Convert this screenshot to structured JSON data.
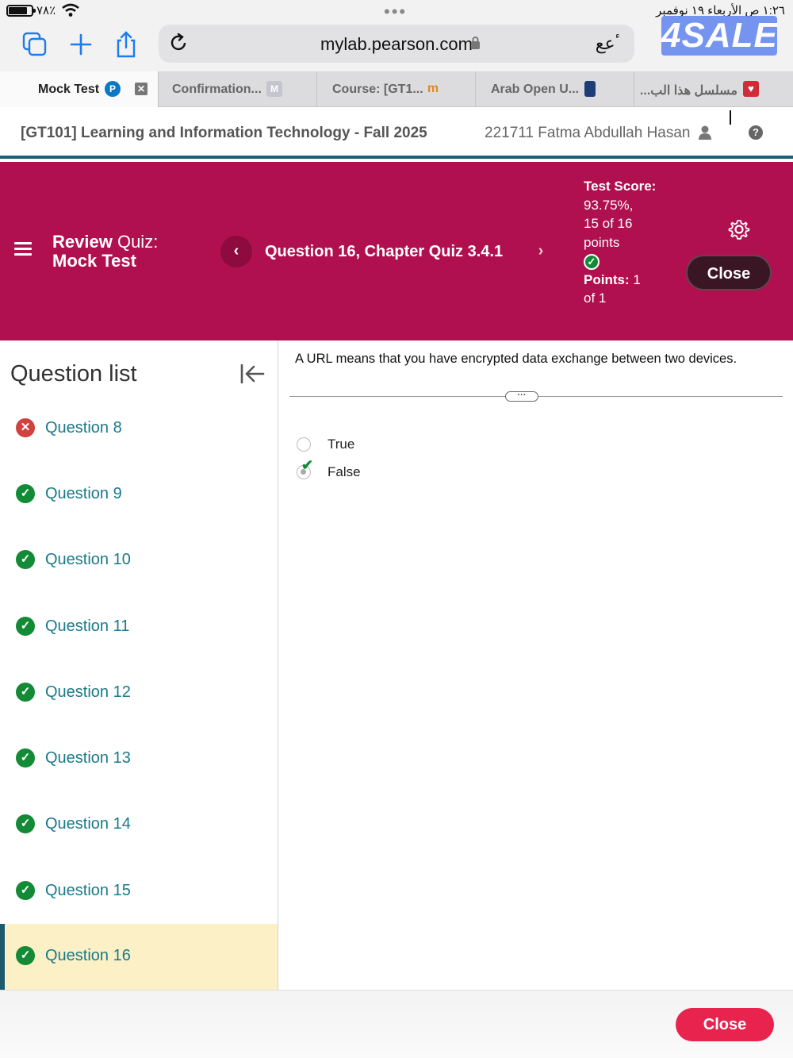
{
  "status_bar": {
    "battery_percent": "٧٨٪",
    "battery_level": 0.78,
    "time_date": "١:٢٦ ص   الأربعاء ١٩ نوفمبر"
  },
  "browser": {
    "url": "mylab.pearson.com",
    "text_size_label": "ٴعع",
    "watermark": "4SALE",
    "icons": [
      "tabs-icon",
      "new-tab-icon",
      "share-icon",
      "reload-icon",
      "lock-icon"
    ]
  },
  "tabs": [
    {
      "label": "Mock Test",
      "favicon": "P",
      "active": true
    },
    {
      "label": "Confirmation...",
      "favicon": "M",
      "active": false
    },
    {
      "label": "Course: [GT1...",
      "favicon": "m",
      "active": false
    },
    {
      "label": "Arab Open U...",
      "favicon": "doc",
      "active": false
    },
    {
      "label": "مسلسل هذا الب...",
      "favicon": "heart",
      "active": false
    }
  ],
  "course_bar": {
    "title": "[GT101] Learning and Information Technology - Fall 2025",
    "user": "221711 Fatma Abdullah Hasan",
    "help": "?"
  },
  "quiz_header": {
    "review_label": "Review",
    "quiz_label": "Quiz:",
    "test_name": "Mock Test",
    "prev_symbol": "‹",
    "next_symbol": "›",
    "question_title": "Question 16, Chapter Quiz 3.4.1",
    "score_label": "Test Score:",
    "score_line1": "93.75%,",
    "score_line2": "15 of 16",
    "score_line3": "points",
    "points_label": "Points:",
    "points_value": "1",
    "points_line2": "of 1",
    "close_label": "Close"
  },
  "sidebar": {
    "title": "Question list",
    "items": [
      {
        "label": "Question 8",
        "status": "incorrect",
        "symbol": "✕"
      },
      {
        "label": "Question 9",
        "status": "correct",
        "symbol": "✓"
      },
      {
        "label": "Question 10",
        "status": "correct",
        "symbol": "✓"
      },
      {
        "label": "Question 11",
        "status": "correct",
        "symbol": "✓"
      },
      {
        "label": "Question 12",
        "status": "correct",
        "symbol": "✓"
      },
      {
        "label": "Question 13",
        "status": "correct",
        "symbol": "✓"
      },
      {
        "label": "Question 14",
        "status": "correct",
        "symbol": "✓"
      },
      {
        "label": "Question 15",
        "status": "correct",
        "symbol": "✓"
      },
      {
        "label": "Question 16",
        "status": "correct",
        "symbol": "✓",
        "current": true
      }
    ]
  },
  "question": {
    "text": "A URL means that you have encrypted data exchange between two devices.",
    "handle": "···",
    "options": [
      {
        "label": "True",
        "selected": false
      },
      {
        "label": "False",
        "selected": true,
        "marked_correct": true
      }
    ]
  },
  "footer": {
    "close_label": "Close"
  },
  "colors": {
    "header_bg": "#b0104f",
    "accent_teal": "#1e5f74",
    "correct_green": "#138a36",
    "incorrect_red": "#d0413f",
    "close_red": "#e8234e",
    "current_row_bg": "#fbf0c6"
  }
}
